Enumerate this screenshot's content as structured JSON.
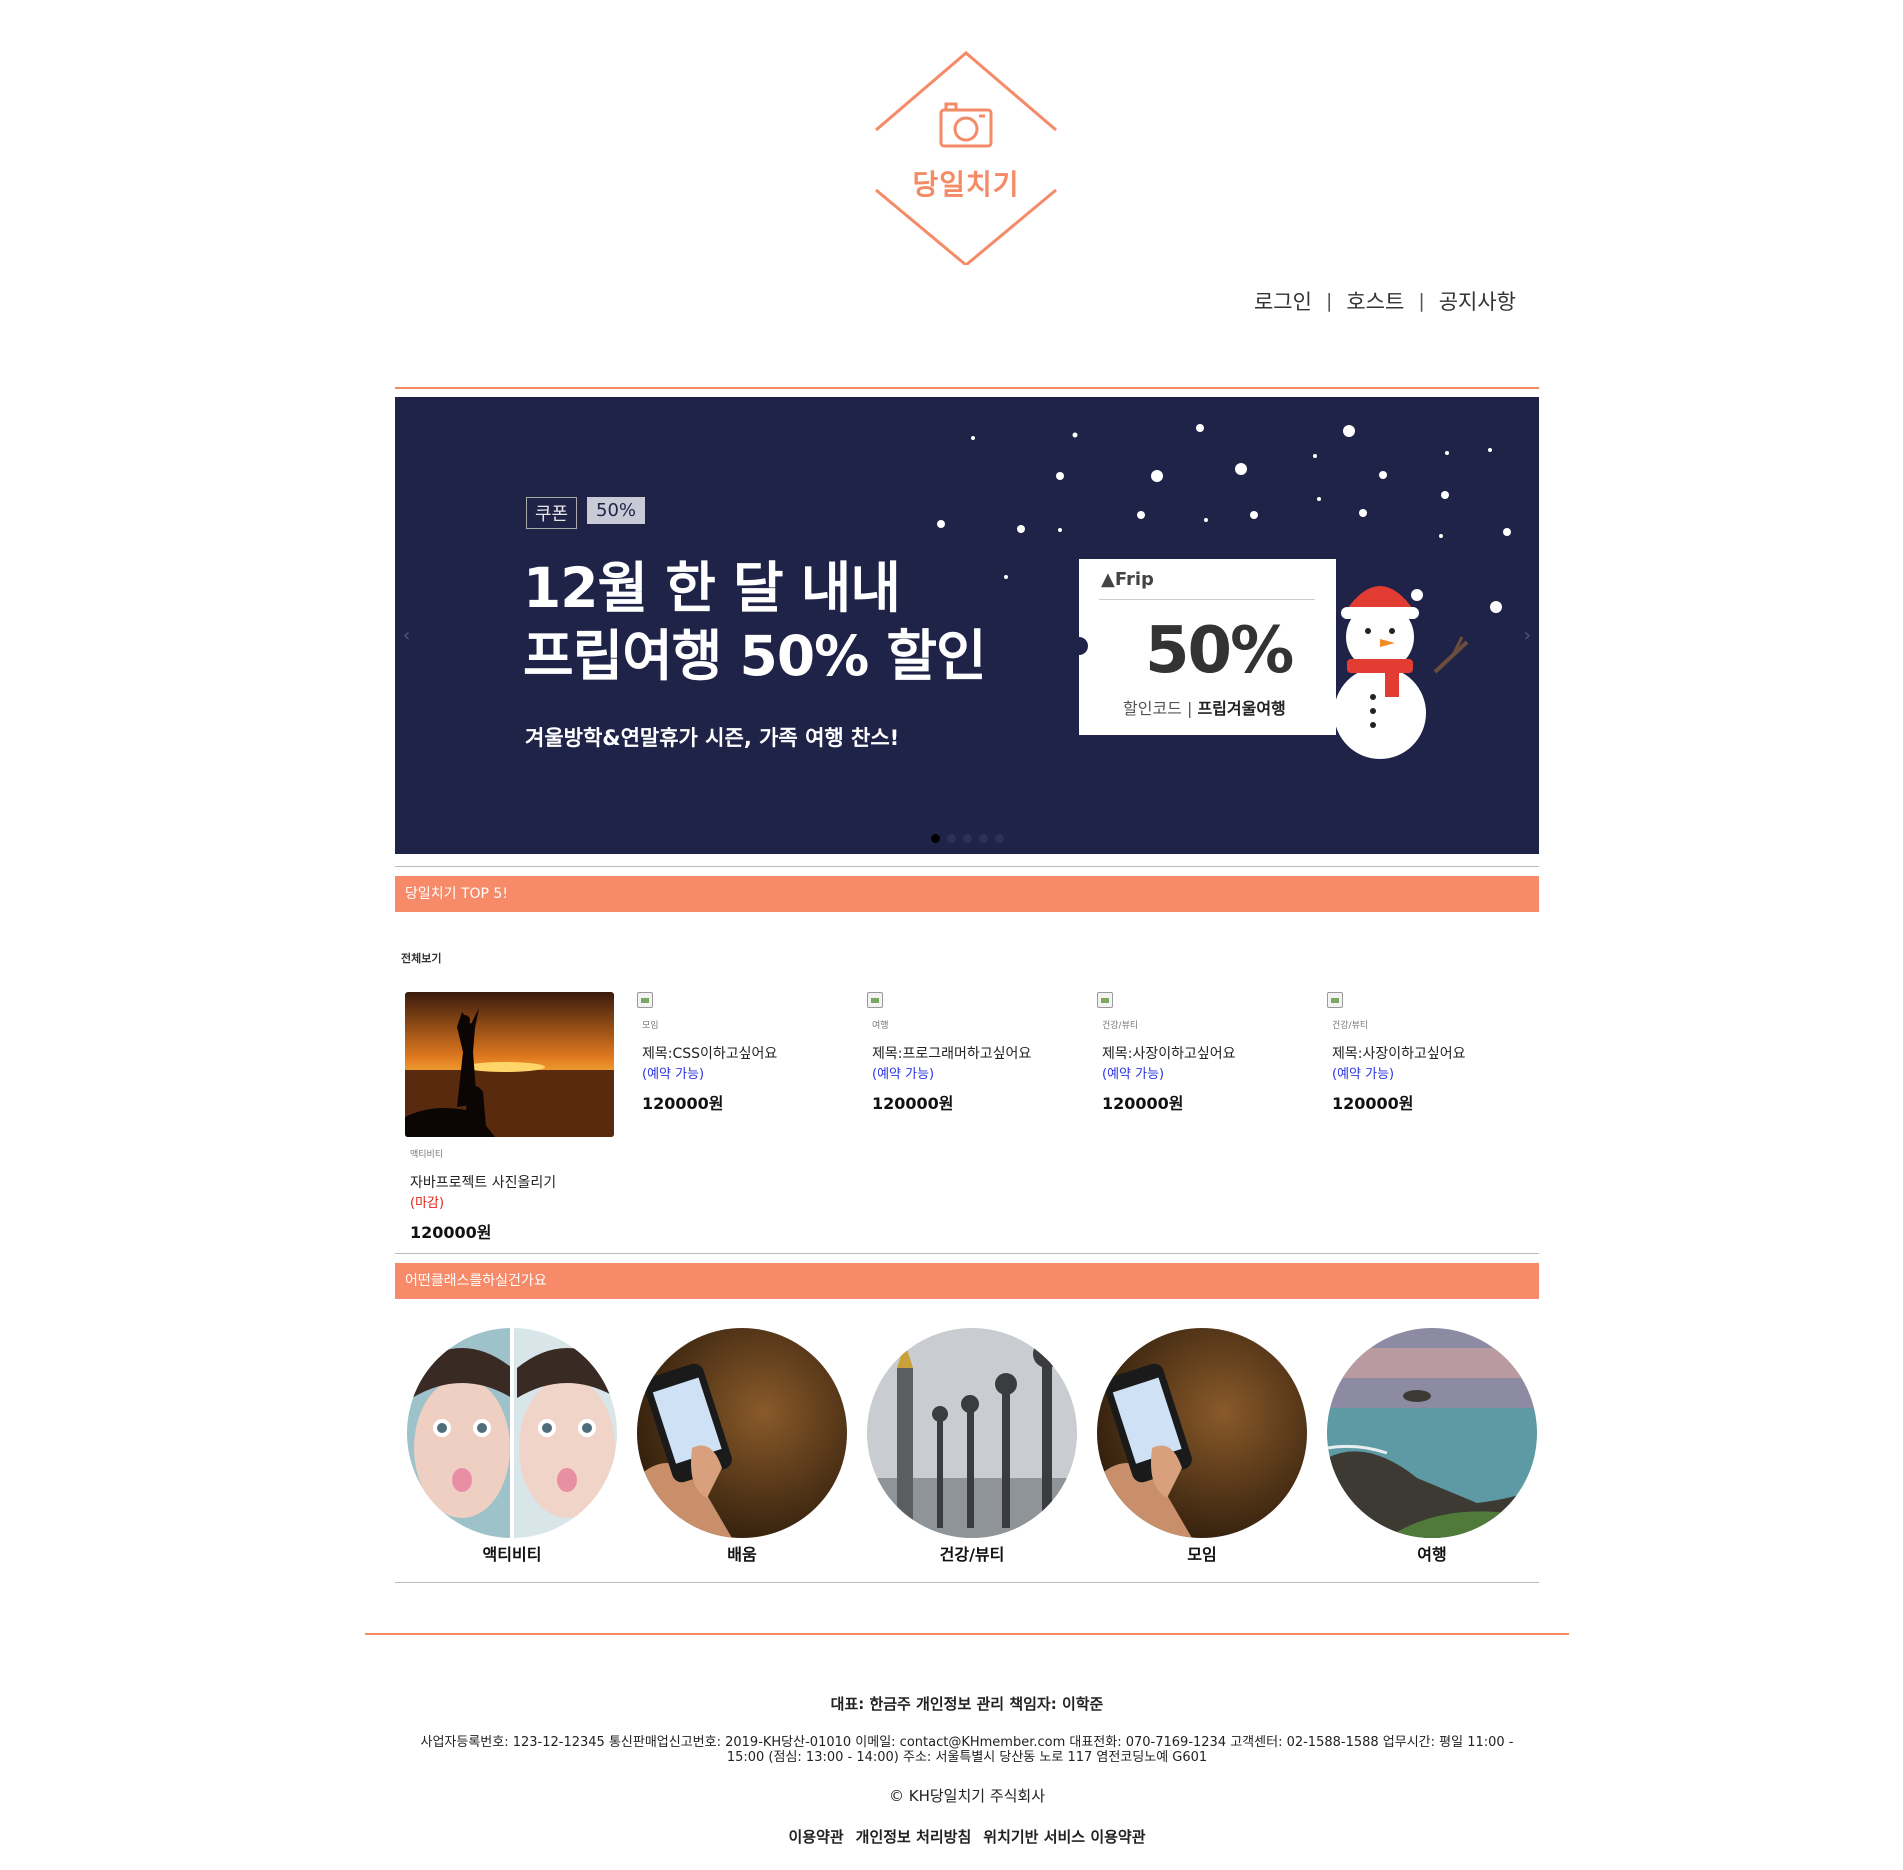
{
  "colors": {
    "accent": "#f48a66",
    "bar": "#f78b69",
    "banner_bg": "#1f2347",
    "open_status": "#2b34e0",
    "closed_status": "#e0231b"
  },
  "logo": {
    "text": "당일치기",
    "icon": "camera-icon"
  },
  "topnav": {
    "login": "로그인",
    "host": "호스트",
    "notice": "공지사항",
    "separator": "|"
  },
  "banner": {
    "tag_coupon": "쿠폰",
    "tag_percent": "50%",
    "headline_1": "12월 한 달 내내",
    "headline_2": "프립여행 50% 할인",
    "subline": "겨울방학&연말휴가 시즌, 가족 여행 찬스!",
    "coupon_brand": "Frip",
    "coupon_value": "50%",
    "coupon_code_label": "할인코드",
    "coupon_code": "프립겨울여행",
    "slides_total": 5,
    "active_slide": 1
  },
  "top5": {
    "heading": "당일치기 TOP 5!",
    "view_all": "전체보기",
    "items": [
      {
        "category": "액티비티",
        "title": "자바프로젝트 사진올리기",
        "status": "(마감)",
        "price": "120000원"
      },
      {
        "category": "모임",
        "title": "제목:CSS이하고싶어요",
        "status": "(예약 가능)",
        "price": "120000원"
      },
      {
        "category": "여행",
        "title": "제목:프로그래머하고싶어요",
        "status": "(예약 가능)",
        "price": "120000원"
      },
      {
        "category": "건강/뷰티",
        "title": "제목:사장이하고싶어요",
        "status": "(예약 가능)",
        "price": "120000원"
      },
      {
        "category": "건강/뷰티",
        "title": "제목:사장이하고싶어요",
        "status": "(예약 가능)",
        "price": "120000원"
      }
    ]
  },
  "classes": {
    "heading": "어떤클래스를하실건가요",
    "items": [
      {
        "label": "액티비티"
      },
      {
        "label": "배움"
      },
      {
        "label": "건강/뷰티"
      },
      {
        "label": "모임"
      },
      {
        "label": "여행"
      }
    ]
  },
  "footer": {
    "representative": "대표: 한금주 개인정보 관리 책임자: 이학준",
    "info": "사업자등록번호: 123-12-12345 통신판매업신고번호: 2019-KH당산-01010 이메일: contact@KHmember.com 대표전화: 070-7169-1234 고객센터: 02-1588-1588 업무시간: 평일 11:00 - 15:00 (점심: 13:00 - 14:00) 주소: 서울특별시 당산동 노로 117 염전코딩노예 G601",
    "copyright": "© KH당일치기 주식회사",
    "links": [
      "이용약관",
      "개인정보 처리방침",
      "위치기반 서비스 이용약관"
    ]
  }
}
